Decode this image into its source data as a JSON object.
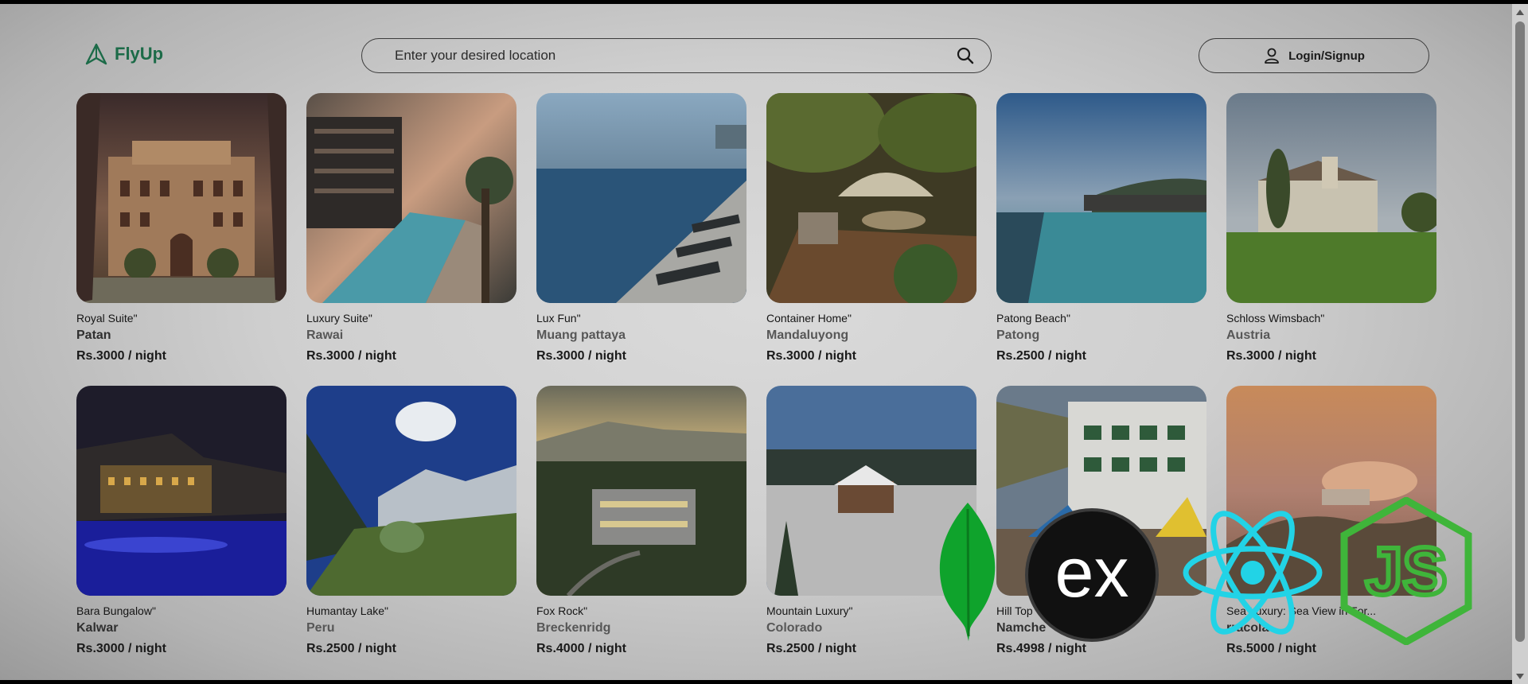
{
  "header": {
    "logo_text": "FlyUp",
    "search_placeholder": "Enter your desired location",
    "login_label": "Login/Signup"
  },
  "listings": [
    {
      "name": "Royal Suite\"",
      "location": "Patan",
      "price": "Rs.3000 / night"
    },
    {
      "name": "Luxury Suite\"",
      "location": "Rawai",
      "price": "Rs.3000 / night"
    },
    {
      "name": "Lux Fun\"",
      "location": "Muang pattaya",
      "price": "Rs.3000 / night"
    },
    {
      "name": "Container Home\"",
      "location": "Mandaluyong",
      "price": "Rs.3000 / night"
    },
    {
      "name": "Patong Beach\"",
      "location": "Patong",
      "price": "Rs.2500 / night"
    },
    {
      "name": "Schloss Wimsbach\"",
      "location": "Austria",
      "price": "Rs.3000 / night"
    },
    {
      "name": "Bara Bungalow\"",
      "location": "Kalwar",
      "price": "Rs.3000 / night"
    },
    {
      "name": "Humantay Lake\"",
      "location": "Peru",
      "price": "Rs.2500 / night"
    },
    {
      "name": "Fox Rock\"",
      "location": "Breckenridg",
      "price": "Rs.4000 / night"
    },
    {
      "name": "Mountain Luxury\"",
      "location": "Colorado",
      "price": "Rs.2500 / night"
    },
    {
      "name": "Hill Top",
      "location": "Namche",
      "price": "Rs.4998 / night"
    },
    {
      "name": "Sea   Luxury: Sea View   in For...",
      "location": "rracola",
      "price": "Rs.5000 / night"
    }
  ],
  "tech_logos": {
    "express_text": "ex",
    "node_text": "JS"
  },
  "colors": {
    "brand": "#1c6b48",
    "mongo_green": "#0fa32c",
    "react_cyan": "#22d3e6",
    "node_green": "#3fb53a"
  }
}
